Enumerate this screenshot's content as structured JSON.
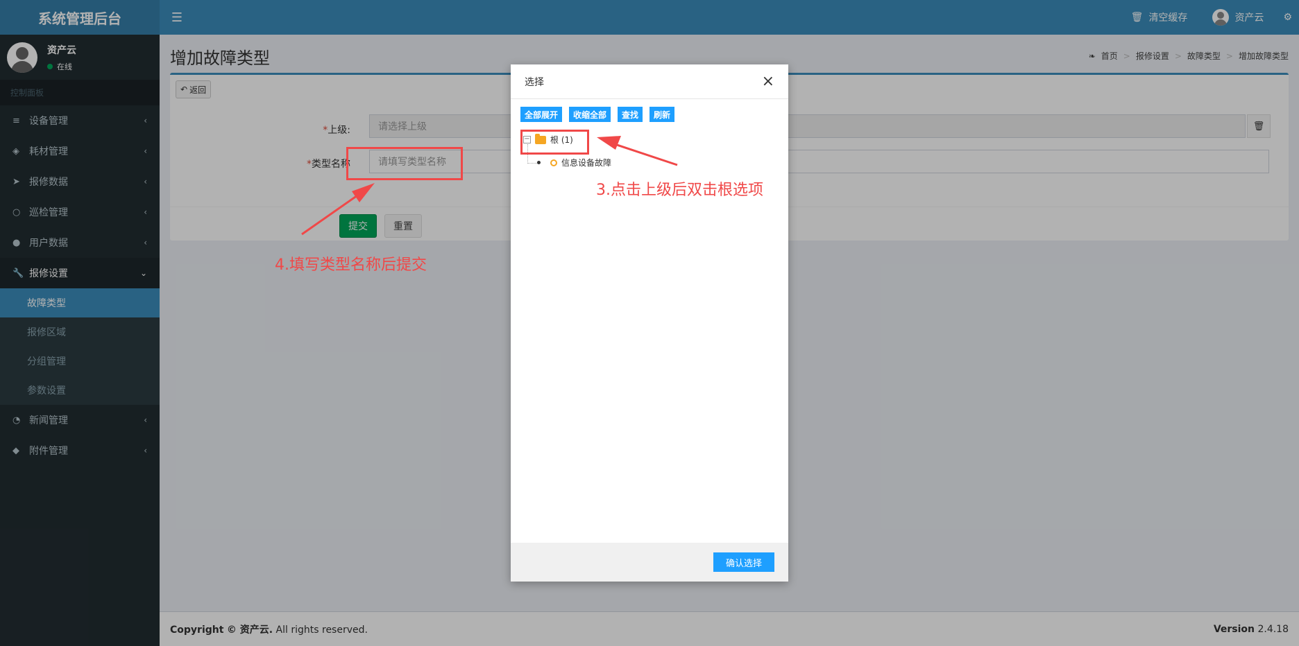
{
  "app": {
    "title": "系统管理后台"
  },
  "topbar": {
    "clear_cache": "清空缓存",
    "user_name": "资产云"
  },
  "sidebar": {
    "user": {
      "name": "资产云",
      "status": "在线"
    },
    "header": "控制面板",
    "items": [
      {
        "label": "设备管理",
        "icon": "database-icon"
      },
      {
        "label": "耗材管理",
        "icon": "cube-icon"
      },
      {
        "label": "报修数据",
        "icon": "paper-plane-icon"
      },
      {
        "label": "巡检管理",
        "icon": "circle-icon"
      },
      {
        "label": "用户数据",
        "icon": "user-icon"
      },
      {
        "label": "报修设置",
        "icon": "wrench-icon"
      },
      {
        "label": "新闻管理",
        "icon": "rss-icon"
      },
      {
        "label": "附件管理",
        "icon": "tags-icon"
      }
    ],
    "sub_items": [
      "故障类型",
      "报修区域",
      "分组管理",
      "参数设置"
    ]
  },
  "page": {
    "title": "增加故障类型",
    "breadcrumb": [
      "首页",
      "报修设置",
      "故障类型",
      "增加故障类型"
    ],
    "back_label": "返回",
    "parent_label": "上级:",
    "parent_placeholder": "请选择上级",
    "name_label": "类型名称",
    "name_placeholder": "请填写类型名称",
    "required_mark": "*",
    "submit_label": "提交",
    "reset_label": "重置"
  },
  "footer": {
    "copyright_prefix": "Copyright",
    "copyright_owner": "© 资产云.",
    "copyright_suffix": "All rights reserved.",
    "version_label": "Version",
    "version_number": "2.4.18"
  },
  "modal": {
    "title": "选择",
    "close": "×",
    "buttons": [
      "全部展开",
      "收缩全部",
      "查找",
      "刷新"
    ],
    "tree_root": "根 (1)",
    "tree_child": "信息设备故障",
    "confirm_label": "确认选择"
  },
  "annotations": {
    "step3": "3.点击上级后双击根选项",
    "step4": "4.填写类型名称后提交"
  },
  "colors": {
    "primary": "#3c8dbc",
    "success": "#00a65a",
    "annotation": "#f04848",
    "layui_blue": "#1e9fff"
  }
}
